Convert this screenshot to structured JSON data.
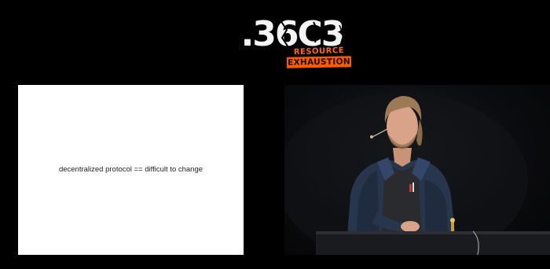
{
  "logo": {
    "number": ".36C3",
    "subtitle": "RESOURCE",
    "tagline": "EXHAUSTION",
    "accent_color": "#ff5a00"
  },
  "slide": {
    "text": "decentralized protocol == difficult to change"
  },
  "video": {
    "subject": "speaker-at-podium"
  }
}
